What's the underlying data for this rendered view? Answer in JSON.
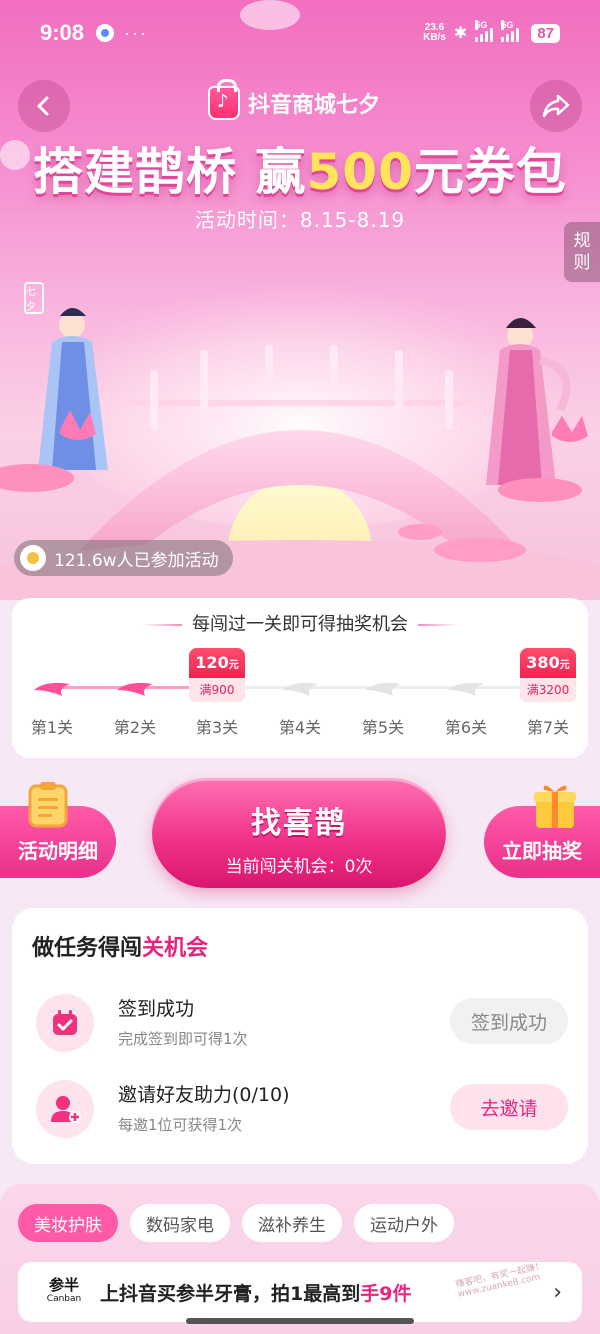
{
  "status_bar": {
    "time": "9:08",
    "dots": "···",
    "speed_value": "23.6",
    "speed_unit": "KB/s",
    "bluetooth": "✱",
    "sim1": "5G",
    "sim2": "5G",
    "battery": "87"
  },
  "header": {
    "logo_text": "抖音商城七夕",
    "headline_part1": "搭建鹊桥 赢",
    "headline_highlight": "500",
    "headline_part2": "元券包",
    "activity_time": "活动时间：8.15-8.19",
    "rules_line1": "规",
    "rules_line2": "则",
    "seal_text": "七夕",
    "participants": "121.6w人已参加活动"
  },
  "levels": {
    "title": "每闯过一关即可得抽奖机会",
    "items": [
      {
        "label": "第1关",
        "status": "passed"
      },
      {
        "label": "第2关",
        "status": "passed"
      },
      {
        "label": "第3关",
        "status": "reward"
      },
      {
        "label": "第4关",
        "status": "locked"
      },
      {
        "label": "第5关",
        "status": "locked"
      },
      {
        "label": "第6关",
        "status": "locked"
      },
      {
        "label": "第7关",
        "status": "reward"
      }
    ],
    "reward1": {
      "amount": "120",
      "unit": "元",
      "condition": "满900"
    },
    "reward2": {
      "amount": "380",
      "unit": "元",
      "condition": "满3200"
    }
  },
  "actions": {
    "details_label": "活动明细",
    "main_title": "找喜鹊",
    "main_sub": "当前闯关机会：0次",
    "draw_label": "立即抽奖"
  },
  "tasks": {
    "title_plain": "做任务得闯",
    "title_accent": "关机会",
    "items": [
      {
        "name": "签到成功",
        "desc": "完成签到即可得1次",
        "button": "签到成功",
        "icon": "calendar-check-icon"
      },
      {
        "name": "邀请好友助力(0/10)",
        "desc": "每邀1位可获得1次",
        "button": "去邀请",
        "icon": "add-user-icon"
      }
    ]
  },
  "categories": {
    "chips": [
      "美妆护肤",
      "数码家电",
      "滋补养生",
      "运动户外"
    ],
    "active": "美妆护肤"
  },
  "promo": {
    "brand_cn": "参半",
    "brand_en": "Canban",
    "text_plain": "上抖音买参半牙膏，拍1最高到",
    "text_emph": "手9件",
    "arrow": "›"
  },
  "watermark": "赚客吧，有奖一起赚！ www.zuanke8.com",
  "colors": {
    "brand_pink": "#e8247f",
    "accent_yellow": "#ffe45c",
    "reward_red": "#ff3060"
  }
}
